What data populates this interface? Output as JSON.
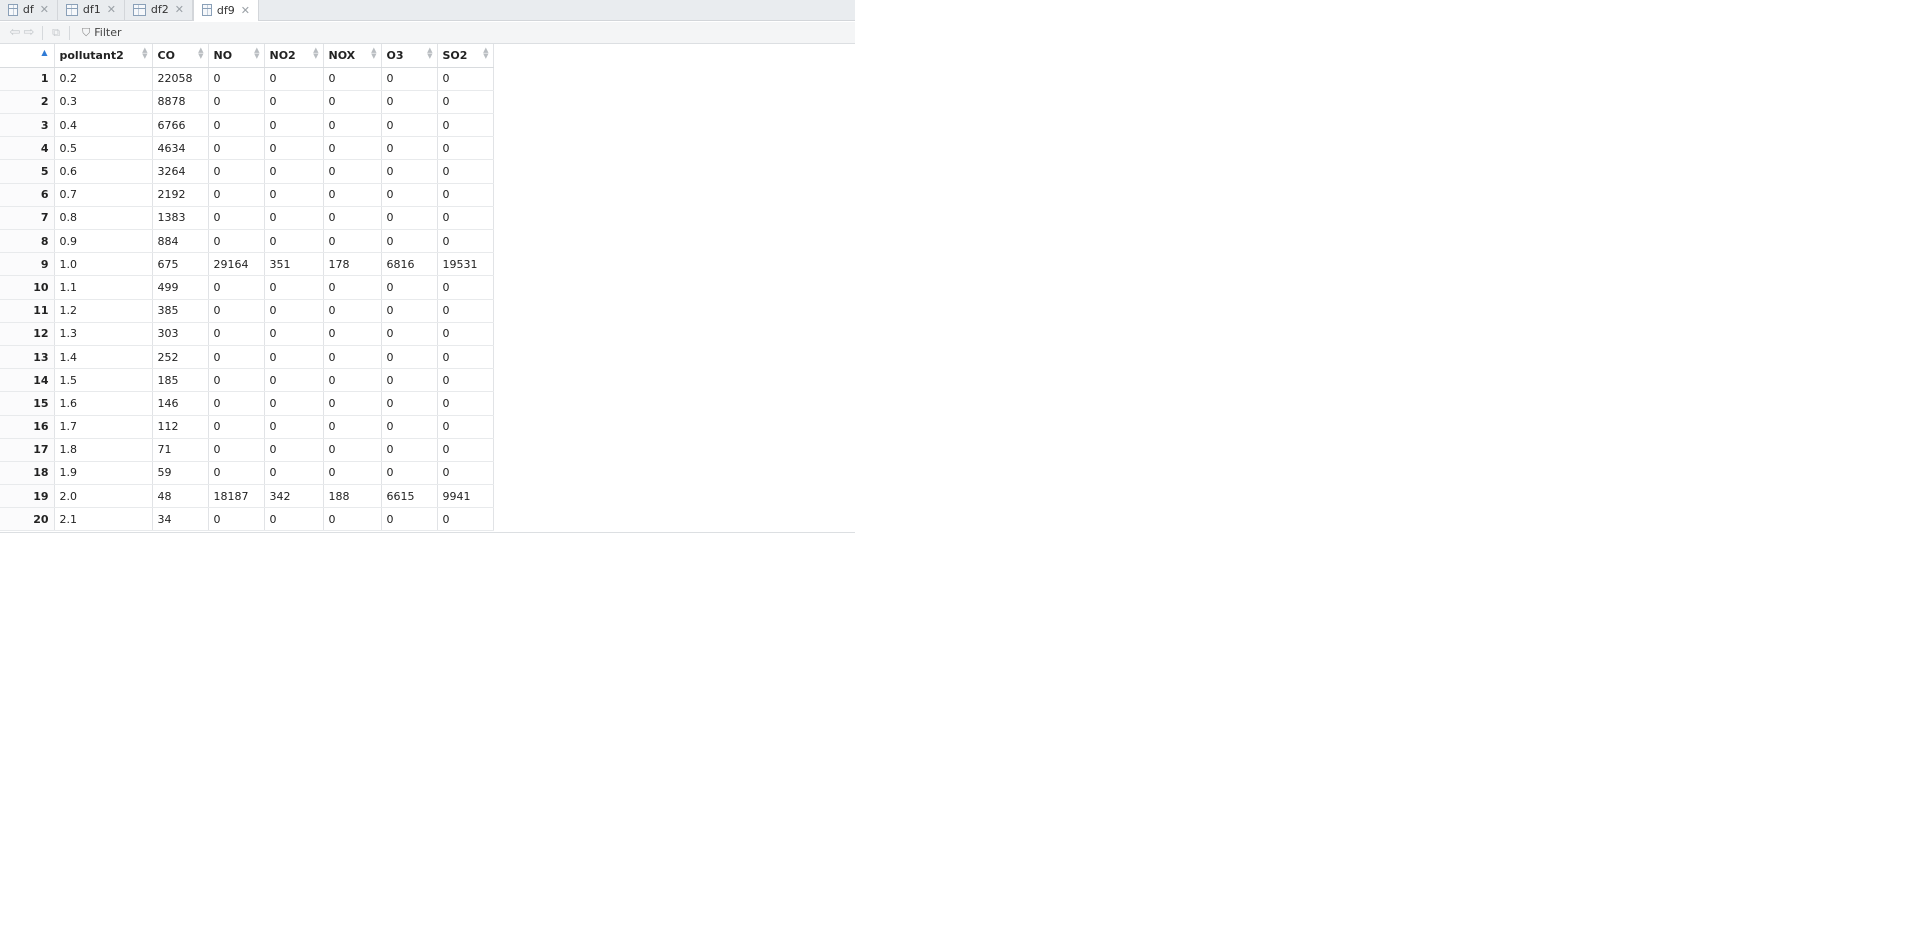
{
  "tabs": [
    {
      "label": "df",
      "active": false
    },
    {
      "label": "df1",
      "active": false
    },
    {
      "label": "df2",
      "active": false
    },
    {
      "label": "df9",
      "active": true
    }
  ],
  "toolbar": {
    "back_icon": "arrow-left-icon",
    "forward_icon": "arrow-right-icon",
    "popout_icon": "popout-icon",
    "filter_label": "Filter"
  },
  "table": {
    "columns": [
      "pollutant2",
      "CO",
      "NO",
      "NO2",
      "NOX",
      "O3",
      "SO2"
    ],
    "rows": [
      [
        "1",
        "0.2",
        "22058",
        "0",
        "0",
        "0",
        "0",
        "0"
      ],
      [
        "2",
        "0.3",
        "8878",
        "0",
        "0",
        "0",
        "0",
        "0"
      ],
      [
        "3",
        "0.4",
        "6766",
        "0",
        "0",
        "0",
        "0",
        "0"
      ],
      [
        "4",
        "0.5",
        "4634",
        "0",
        "0",
        "0",
        "0",
        "0"
      ],
      [
        "5",
        "0.6",
        "3264",
        "0",
        "0",
        "0",
        "0",
        "0"
      ],
      [
        "6",
        "0.7",
        "2192",
        "0",
        "0",
        "0",
        "0",
        "0"
      ],
      [
        "7",
        "0.8",
        "1383",
        "0",
        "0",
        "0",
        "0",
        "0"
      ],
      [
        "8",
        "0.9",
        "884",
        "0",
        "0",
        "0",
        "0",
        "0"
      ],
      [
        "9",
        "1.0",
        "675",
        "29164",
        "351",
        "178",
        "6816",
        "19531"
      ],
      [
        "10",
        "1.1",
        "499",
        "0",
        "0",
        "0",
        "0",
        "0"
      ],
      [
        "11",
        "1.2",
        "385",
        "0",
        "0",
        "0",
        "0",
        "0"
      ],
      [
        "12",
        "1.3",
        "303",
        "0",
        "0",
        "0",
        "0",
        "0"
      ],
      [
        "13",
        "1.4",
        "252",
        "0",
        "0",
        "0",
        "0",
        "0"
      ],
      [
        "14",
        "1.5",
        "185",
        "0",
        "0",
        "0",
        "0",
        "0"
      ],
      [
        "15",
        "1.6",
        "146",
        "0",
        "0",
        "0",
        "0",
        "0"
      ],
      [
        "16",
        "1.7",
        "112",
        "0",
        "0",
        "0",
        "0",
        "0"
      ],
      [
        "17",
        "1.8",
        "71",
        "0",
        "0",
        "0",
        "0",
        "0"
      ],
      [
        "18",
        "1.9",
        "59",
        "0",
        "0",
        "0",
        "0",
        "0"
      ],
      [
        "19",
        "2.0",
        "48",
        "18187",
        "342",
        "188",
        "6615",
        "9941"
      ],
      [
        "20",
        "2.1",
        "34",
        "0",
        "0",
        "0",
        "0",
        "0"
      ]
    ]
  }
}
